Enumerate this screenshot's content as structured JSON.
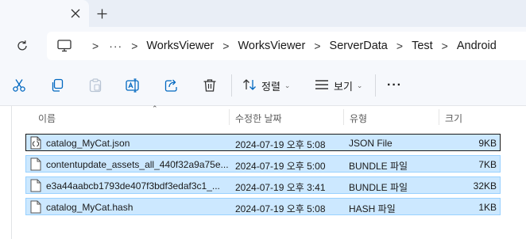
{
  "window": {
    "tab_close_icon": "close-icon",
    "new_tab_icon": "plus-icon"
  },
  "address": {
    "refresh_icon": "refresh-icon",
    "root_icon": "this-pc-icon",
    "overflow": "···",
    "path": [
      "WorksViewer",
      "WorksViewer",
      "ServerData",
      "Test",
      "Android"
    ]
  },
  "toolbar": {
    "cut_icon": "scissors-icon",
    "copy_icon": "copy-icon",
    "paste_icon": "paste-icon",
    "rename_icon": "rename-icon",
    "share_icon": "share-icon",
    "delete_icon": "trash-icon",
    "sort_label": "정렬",
    "view_label": "보기",
    "more_label": "···"
  },
  "columns": {
    "name": "이름",
    "date": "수정한 날짜",
    "type": "유형",
    "size": "크기"
  },
  "files": [
    {
      "name": "catalog_MyCat.json",
      "date": "2024-07-19 오후 5:08",
      "type": "JSON File",
      "size": "9KB",
      "icon": "json-file-icon"
    },
    {
      "name": "contentupdate_assets_all_440f32a9a75e...",
      "date": "2024-07-19 오후 5:00",
      "type": "BUNDLE 파일",
      "size": "7KB",
      "icon": "file-icon"
    },
    {
      "name": "e3a44aabcb1793de407f3bdf3edaf3c1_...",
      "date": "2024-07-19 오후 3:41",
      "type": "BUNDLE 파일",
      "size": "32KB",
      "icon": "file-icon"
    },
    {
      "name": "catalog_MyCat.hash",
      "date": "2024-07-19 오후 5:08",
      "type": "HASH 파일",
      "size": "1KB",
      "icon": "file-icon"
    }
  ],
  "colors": {
    "selection_bg": "#cce8ff",
    "selection_border": "#99d1ff",
    "toolbar_accent": "#0067c0"
  }
}
